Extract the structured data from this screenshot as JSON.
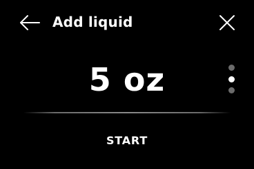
{
  "header": {
    "title": "Add liquid",
    "back_icon": "arrow-left-icon",
    "close_icon": "close-icon"
  },
  "amount": {
    "display": "5 oz"
  },
  "pager": {
    "total": 3,
    "active_index": 2
  },
  "actions": {
    "start_label": "START"
  },
  "colors": {
    "background": "#000000",
    "foreground": "#ffffff",
    "inactive_dot": "#6b6b6b"
  }
}
